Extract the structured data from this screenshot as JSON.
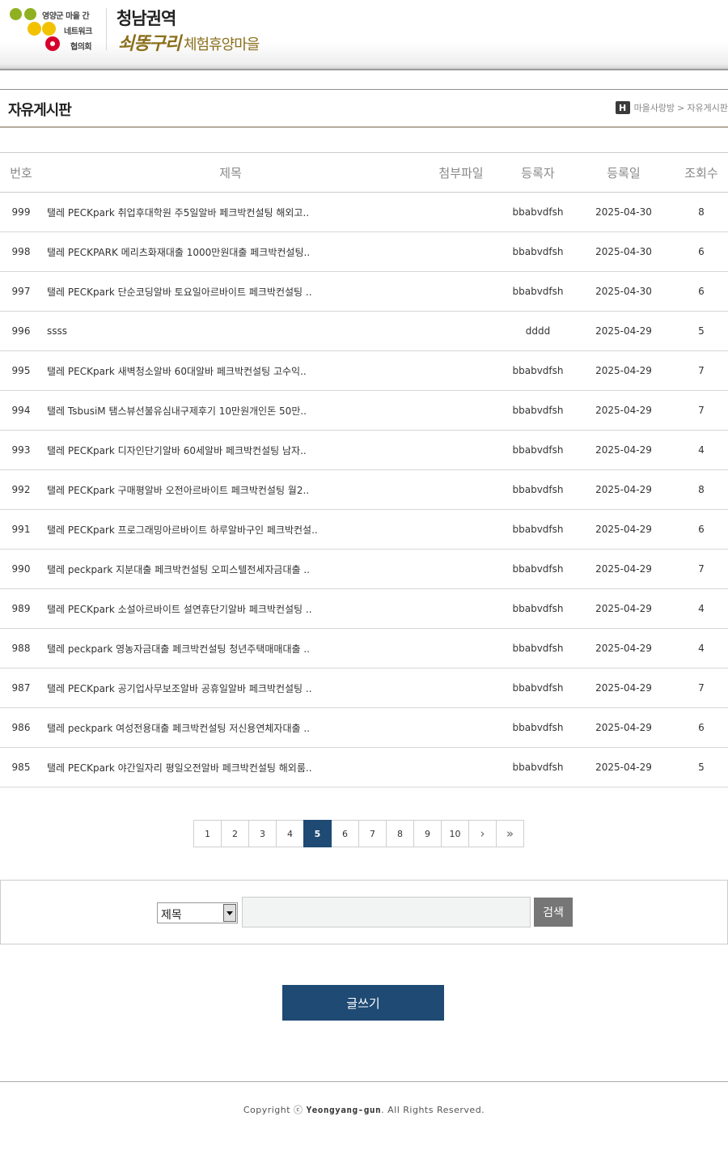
{
  "header": {
    "logo_text_1": "영양군 마을 간",
    "logo_text_2": "네트워크",
    "logo_text_3": "협의회",
    "title_line1": "청남권역",
    "title_brush": "쇠똥구리",
    "title_rest": "체험휴양마을"
  },
  "page": {
    "title": "자유게시판",
    "breadcrumb_home": "H",
    "breadcrumb_1": "마을사랑방",
    "breadcrumb_sep": ">",
    "breadcrumb_2": "자유게시판"
  },
  "table": {
    "headers": {
      "no": "번호",
      "subject": "제목",
      "attach": "첨부파일",
      "writer": "등록자",
      "date": "등록일",
      "views": "조회수"
    },
    "rows": [
      {
        "no": "999",
        "subject": "탤레 PECKpark 취업후대학원 주5일알바 페크박컨설팅 해외고..",
        "attach": "",
        "writer": "bbabvdfsh",
        "date": "2025-04-30",
        "views": "8"
      },
      {
        "no": "998",
        "subject": "탤레 PECKPARK 메리츠화재대출 1000만원대출 페크박컨설팅..",
        "attach": "",
        "writer": "bbabvdfsh",
        "date": "2025-04-30",
        "views": "6"
      },
      {
        "no": "997",
        "subject": "탤레 PECKpark 단순코딩알바 토요일아르바이트 페크박컨설팅 ..",
        "attach": "",
        "writer": "bbabvdfsh",
        "date": "2025-04-30",
        "views": "6"
      },
      {
        "no": "996",
        "subject": "ssss",
        "attach": "",
        "writer": "dddd",
        "date": "2025-04-29",
        "views": "5"
      },
      {
        "no": "995",
        "subject": "탤레 PECKpark 새벽청소알바 60대알바 페크박컨설팅 고수익..",
        "attach": "",
        "writer": "bbabvdfsh",
        "date": "2025-04-29",
        "views": "7"
      },
      {
        "no": "994",
        "subject": "탤레 TsbusiM 탬스뷰선불유심내구제후기 10만원개인돈 50만..",
        "attach": "",
        "writer": "bbabvdfsh",
        "date": "2025-04-29",
        "views": "7"
      },
      {
        "no": "993",
        "subject": "탤레 PECKpark 디자인단기알바 60세알바 페크박컨설팅 남자..",
        "attach": "",
        "writer": "bbabvdfsh",
        "date": "2025-04-29",
        "views": "4"
      },
      {
        "no": "992",
        "subject": "탤레 PECKpark 구매평알바 오전아르바이트 페크박컨설팅 월2..",
        "attach": "",
        "writer": "bbabvdfsh",
        "date": "2025-04-29",
        "views": "8"
      },
      {
        "no": "991",
        "subject": "탤레 PECKpark 프로그래밍아르바이트 하루알바구인 페크박컨설..",
        "attach": "",
        "writer": "bbabvdfsh",
        "date": "2025-04-29",
        "views": "6"
      },
      {
        "no": "990",
        "subject": "탤레 peckpark 지분대출 페크박컨설팅 오피스텔전세자금대출 ..",
        "attach": "",
        "writer": "bbabvdfsh",
        "date": "2025-04-29",
        "views": "7"
      },
      {
        "no": "989",
        "subject": "탤레 PECKpark 소설아르바이트 설연휴단기알바 페크박컨설팅 ..",
        "attach": "",
        "writer": "bbabvdfsh",
        "date": "2025-04-29",
        "views": "4"
      },
      {
        "no": "988",
        "subject": "탤레 peckpark 영농자금대출 페크박컨설팅 청년주택매매대출 ..",
        "attach": "",
        "writer": "bbabvdfsh",
        "date": "2025-04-29",
        "views": "4"
      },
      {
        "no": "987",
        "subject": "탤레 PECKpark 공기업사무보조알바 공휴일알바 페크박컨설팅 ..",
        "attach": "",
        "writer": "bbabvdfsh",
        "date": "2025-04-29",
        "views": "7"
      },
      {
        "no": "986",
        "subject": "탤레 peckpark 여성전용대출 페크박컨설팅 저신용연체자대출 ..",
        "attach": "",
        "writer": "bbabvdfsh",
        "date": "2025-04-29",
        "views": "6"
      },
      {
        "no": "985",
        "subject": "탤레 PECKpark 야간일자리 평일오전알바 페크박컨설팅 해외룸..",
        "attach": "",
        "writer": "bbabvdfsh",
        "date": "2025-04-29",
        "views": "5"
      }
    ]
  },
  "pagination": {
    "pages": [
      "1",
      "2",
      "3",
      "4",
      "5",
      "6",
      "7",
      "8",
      "9",
      "10"
    ],
    "current": "5",
    "next_label": "›",
    "last_label": "»"
  },
  "search": {
    "field_selected": "제목",
    "input_value": "",
    "button_label": "검색"
  },
  "write": {
    "label": "글쓰기"
  },
  "footer": {
    "prefix": "Copyright ⓒ ",
    "brand": "Yeongyang-gun",
    "suffix": ". All Rights Reserved."
  },
  "colors": {
    "primary": "#1e4a74",
    "search_button": "#767676",
    "title_gold": "#8a6f1c",
    "logo_green": "#8fb020",
    "logo_yellow": "#f2c200",
    "logo_red": "#d6002a"
  }
}
